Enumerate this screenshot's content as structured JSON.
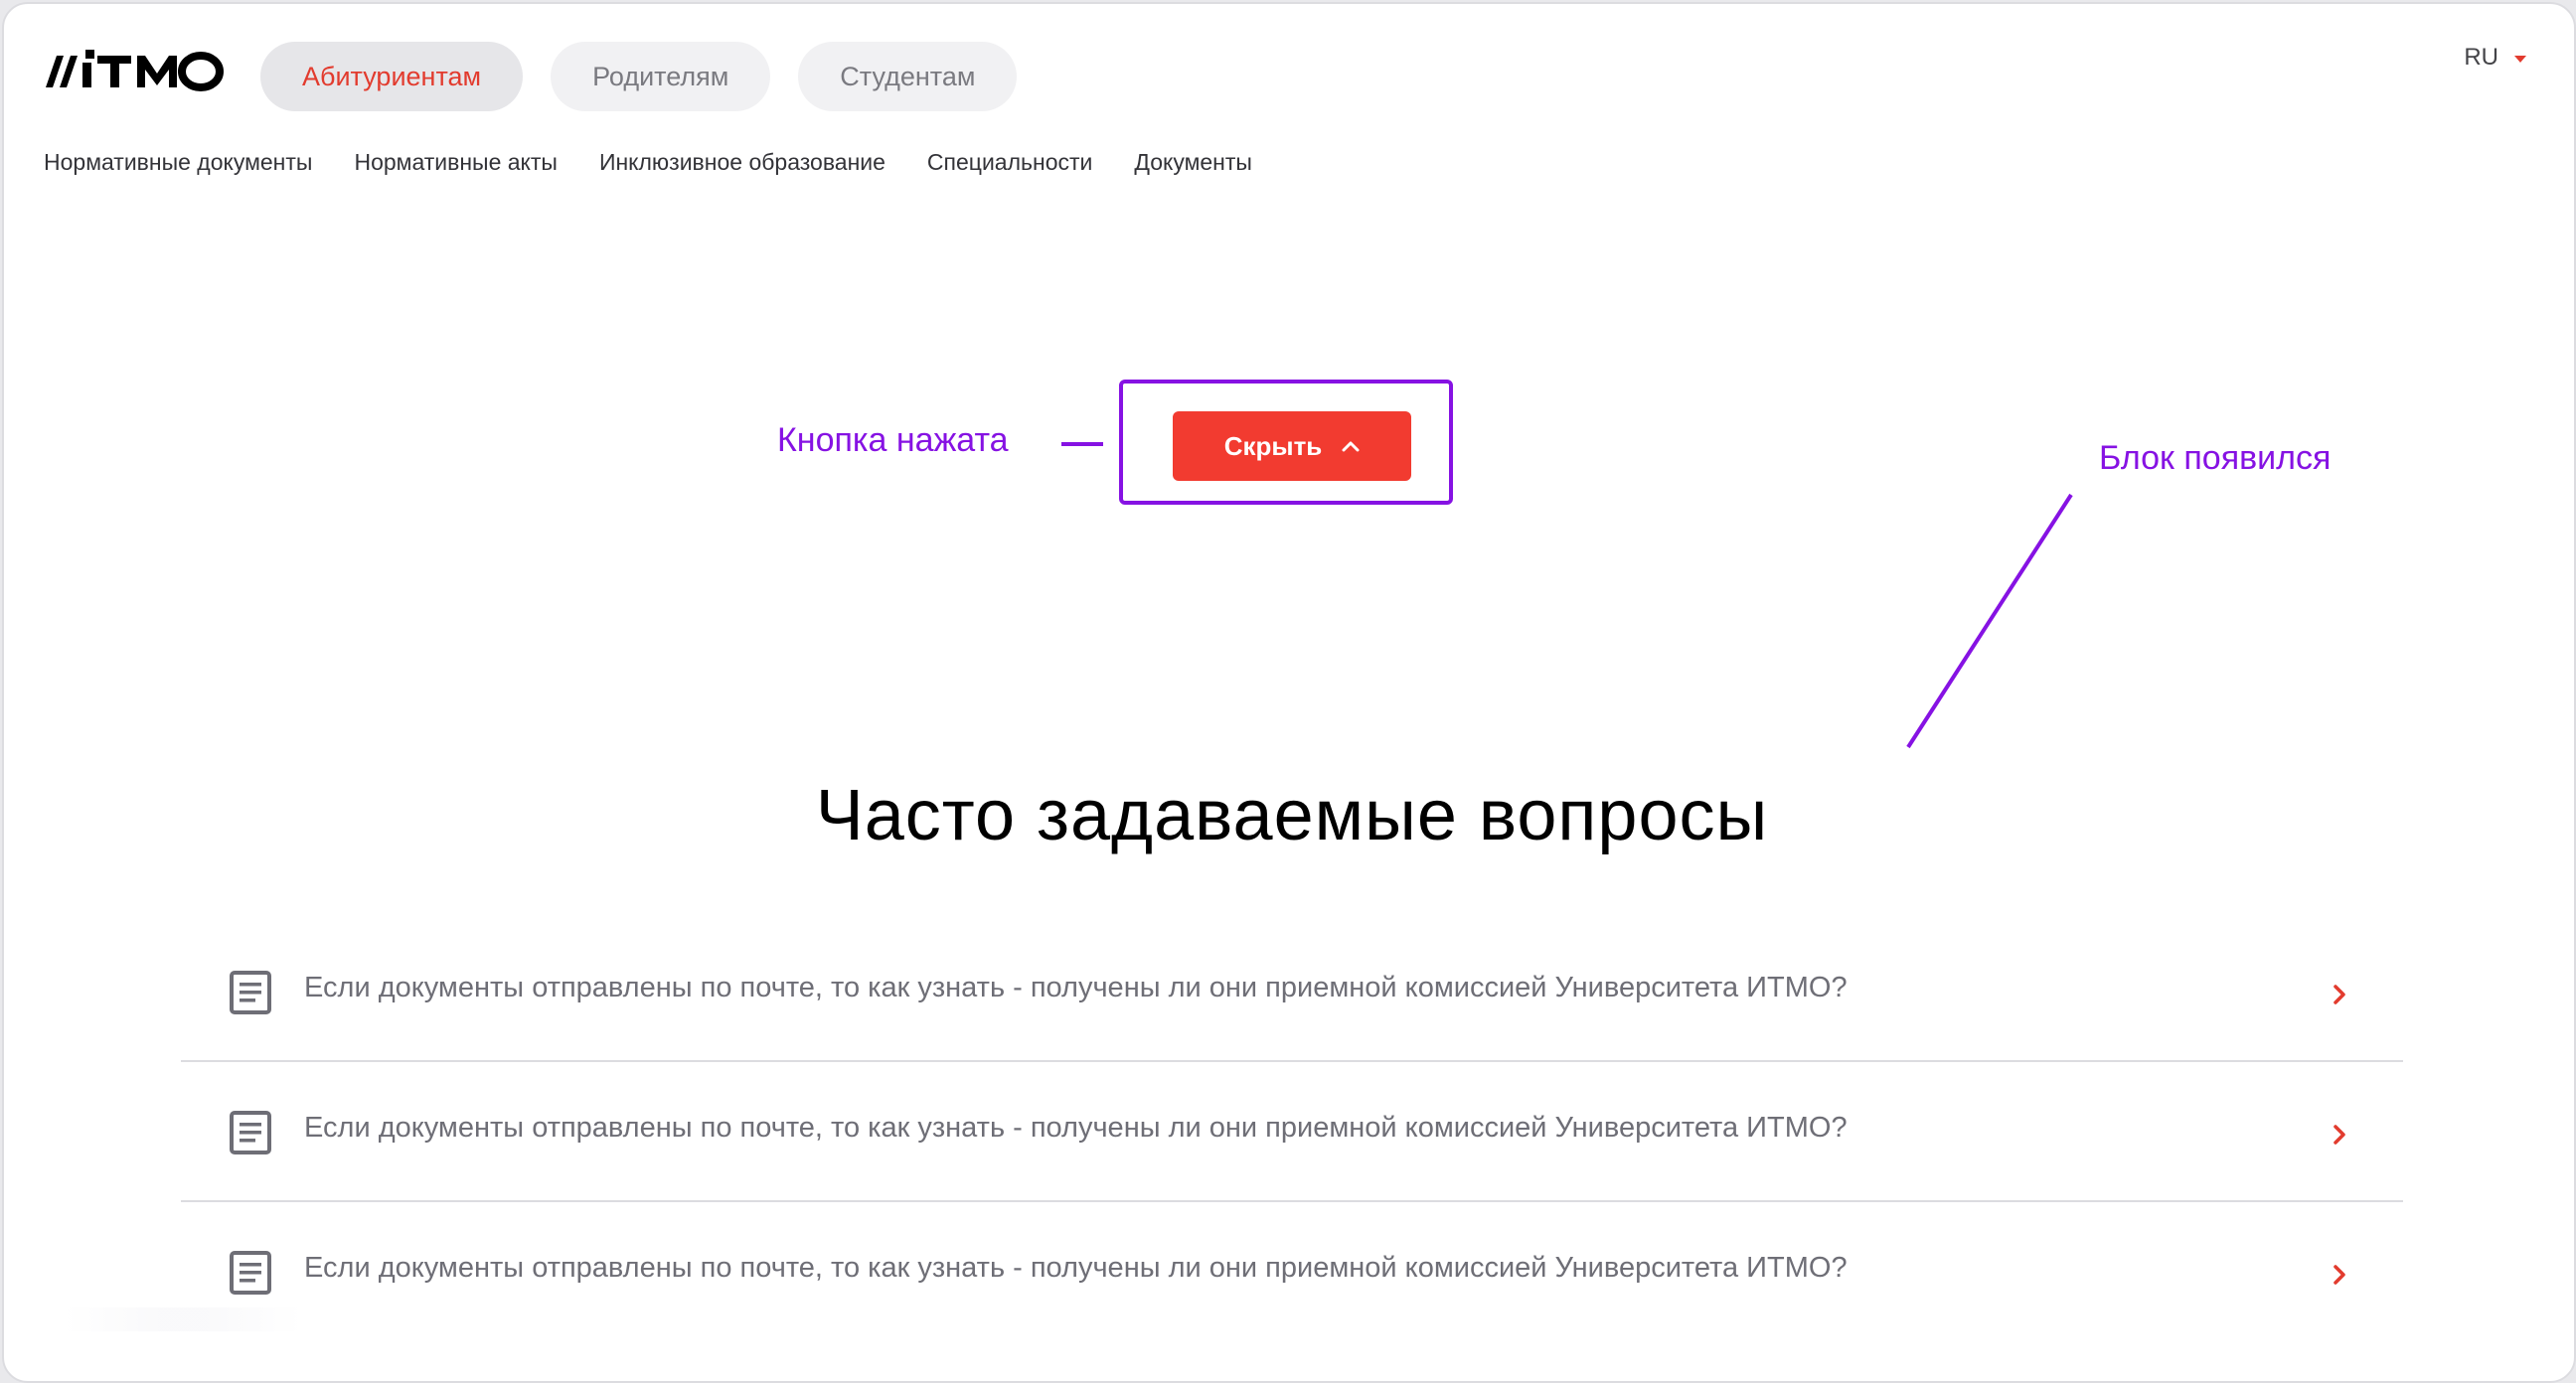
{
  "header": {
    "logo_text": "ITMO",
    "audience_tabs": [
      {
        "label": "Абитуриентам",
        "active": true
      },
      {
        "label": "Родителям",
        "active": false
      },
      {
        "label": "Студентам",
        "active": false
      }
    ],
    "language": "RU"
  },
  "subnav": {
    "items": [
      "Нормативные документы",
      "Нормативные акты",
      "Инклюзивное образование",
      "Специальности",
      "Документы"
    ]
  },
  "annotations": {
    "button_pressed": "Кнопка нажата",
    "block_appeared": "Блок появился"
  },
  "toggle_button": {
    "label": "Скрыть",
    "icon": "chevron-up-icon"
  },
  "faq": {
    "title": "Часто задаваемые вопросы",
    "items": [
      {
        "question": "Если документы отправлены по почте, то как узнать - получены ли они приемной комиссией Университета ИТМО?"
      },
      {
        "question": "Если документы отправлены по почте, то как узнать - получены ли они приемной комиссией Университета ИТМО?"
      },
      {
        "question": "Если документы отправлены по почте, то как узнать - получены ли они приемной комиссией Университета ИТМО?"
      }
    ]
  },
  "colors": {
    "accent_red": "#f23b30",
    "annotation_purple": "#8612e3",
    "active_tab_text": "#e23b2e"
  }
}
